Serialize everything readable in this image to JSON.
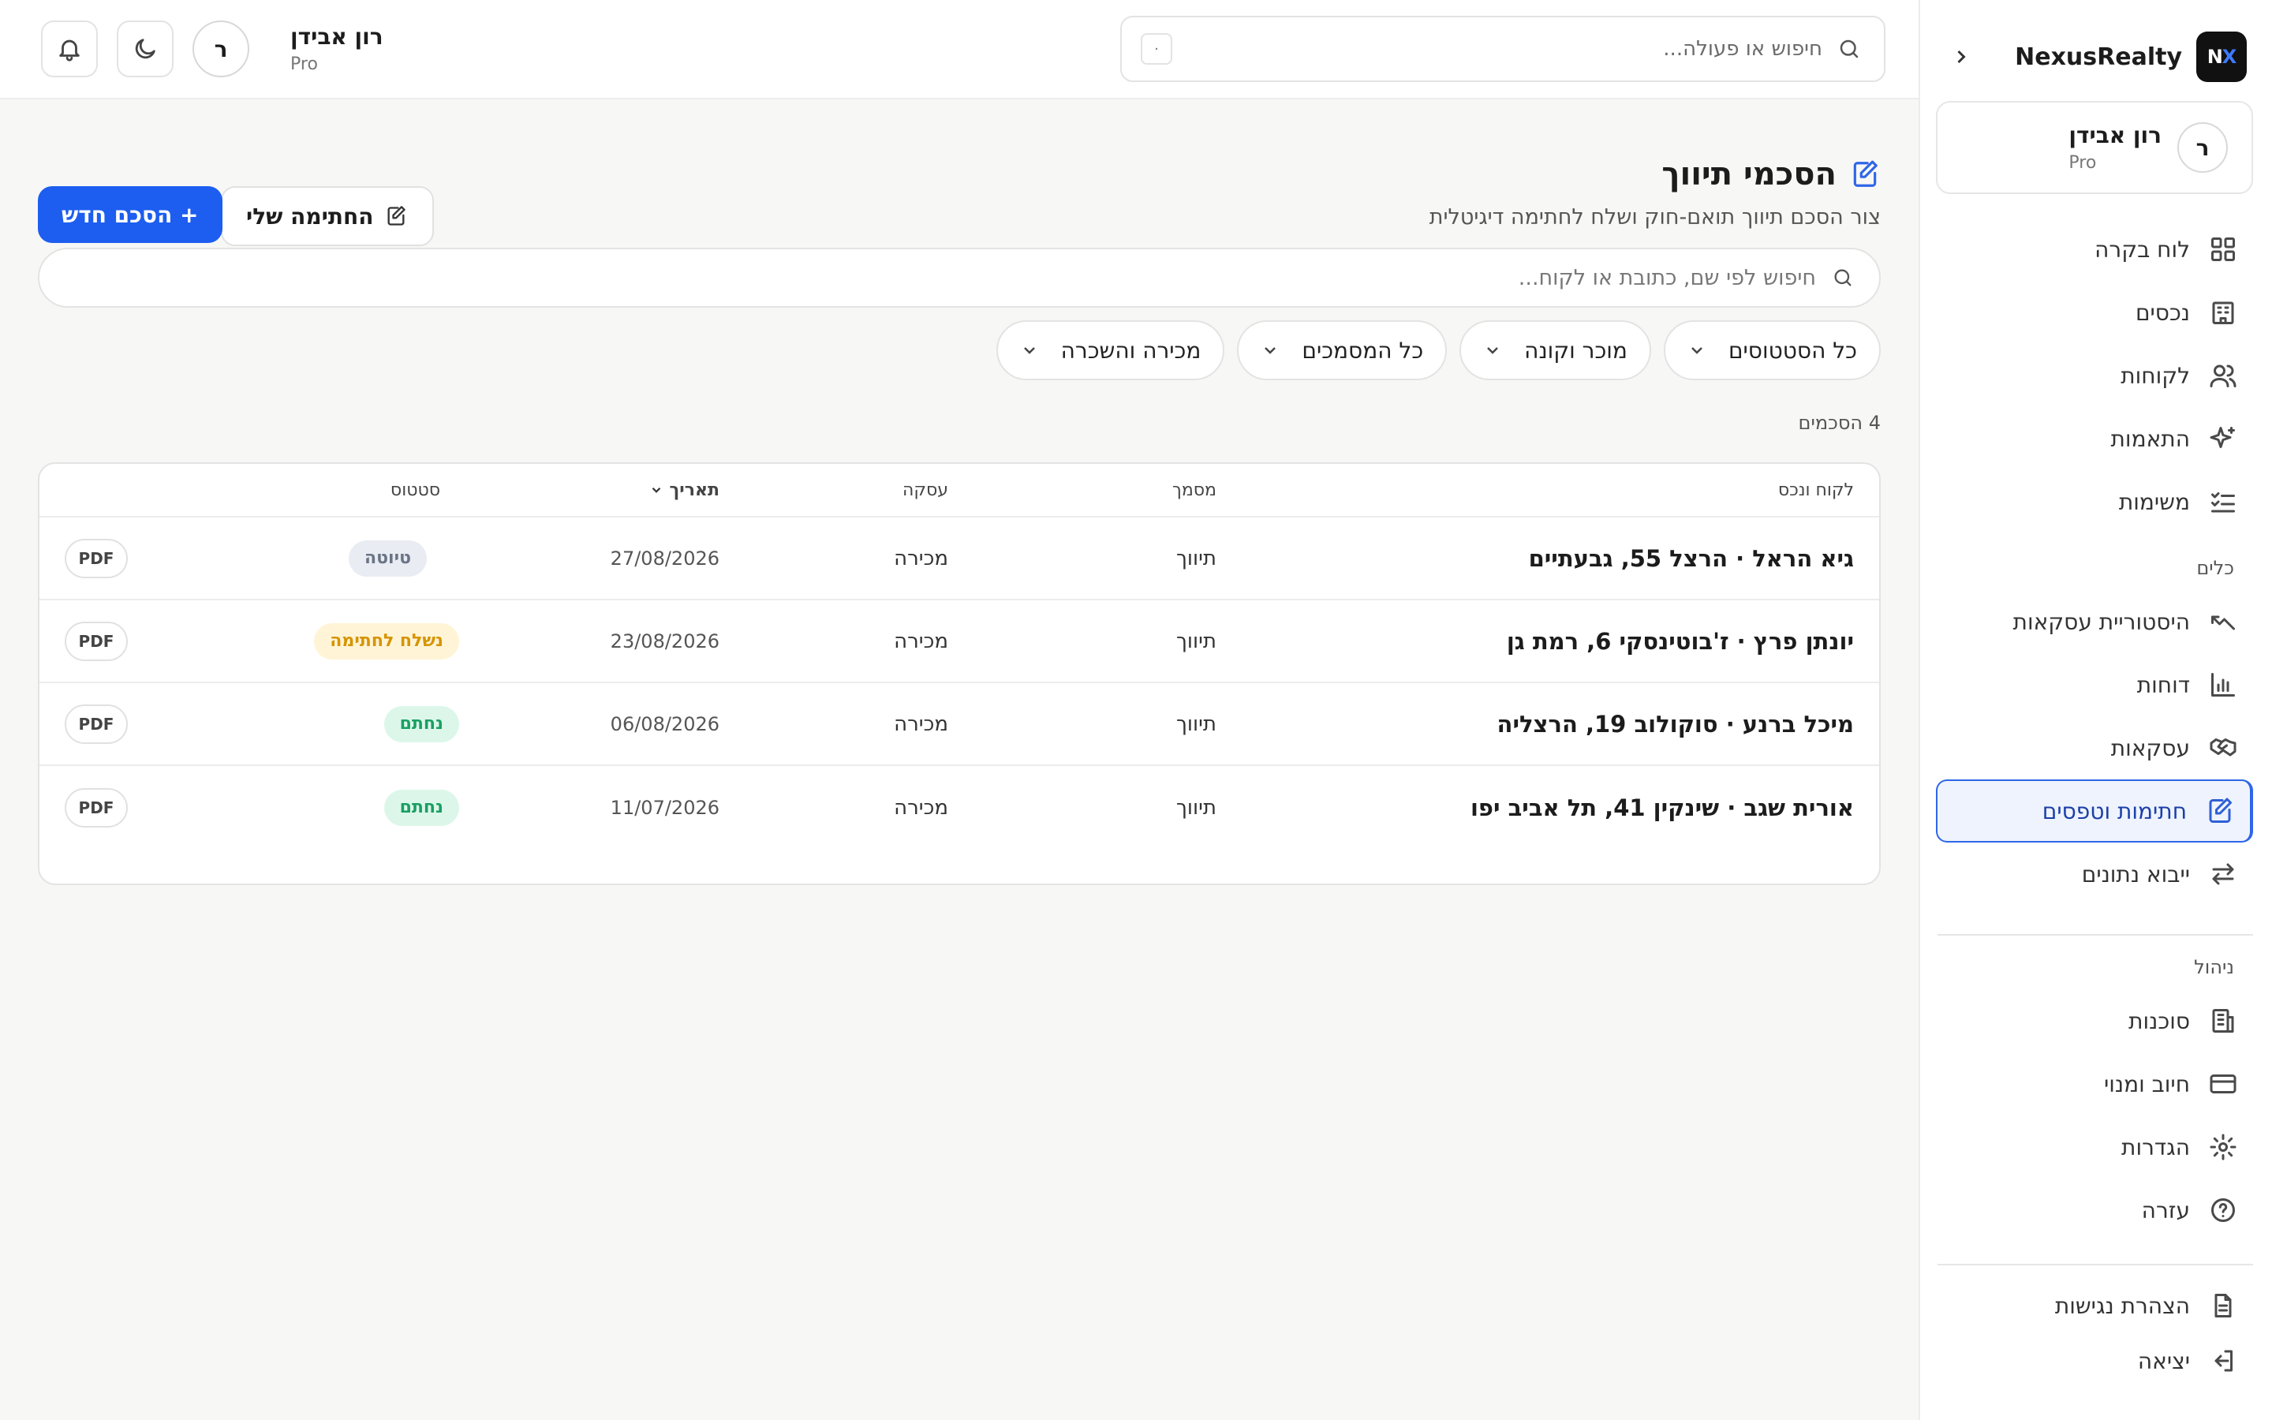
{
  "brand": {
    "name": "NexusRealty",
    "logo_text": "NX"
  },
  "user": {
    "name": "רון אבידן",
    "plan": "Pro",
    "initial": "ר"
  },
  "sidebar": {
    "items": [
      {
        "label": "לוח בקרה",
        "icon": "dashboard-icon"
      },
      {
        "label": "נכסים",
        "icon": "building-icon"
      },
      {
        "label": "לקוחות",
        "icon": "users-icon"
      },
      {
        "label": "התאמות",
        "icon": "sparkles-icon"
      },
      {
        "label": "משימות",
        "icon": "checklist-icon"
      }
    ],
    "tools_title": "כלים",
    "tools": [
      {
        "label": "היסטוריית עסקאות",
        "icon": "trend-icon"
      },
      {
        "label": "דוחות",
        "icon": "bar-chart-icon"
      },
      {
        "label": "עסקאות",
        "icon": "handshake-icon"
      },
      {
        "label": "חתימות וטפסים",
        "icon": "signature-icon",
        "active": true
      },
      {
        "label": "ייבוא נתונים",
        "icon": "arrows-icon"
      }
    ],
    "admin_title": "ניהול",
    "admin": [
      {
        "label": "סוכנות",
        "icon": "office-icon"
      },
      {
        "label": "חיוב ומנוי",
        "icon": "credit-card-icon"
      },
      {
        "label": "הגדרות",
        "icon": "gear-icon"
      },
      {
        "label": "עזרה",
        "icon": "help-icon"
      }
    ],
    "footer": [
      {
        "label": "הצהרת נגישות",
        "icon": "document-icon"
      },
      {
        "label": "יציאה",
        "icon": "logout-icon"
      }
    ]
  },
  "topbar": {
    "search_placeholder": "חיפוש או פעולה...",
    "shortcut": "·"
  },
  "page": {
    "title": "הסכמי תיווך",
    "subtitle": "צור הסכם תיווך תואם-חוק ושלח לחתימה דיגיטלית",
    "new_button": "+ הסכם חדש",
    "signature_button": "החתימה שלי",
    "search_placeholder": "חיפוש לפי שם, כתובת או לקוח...",
    "filters": [
      "כל הסטטוסים",
      "מוכר וקונה",
      "כל המסמכים",
      "מכירה והשכרה"
    ],
    "count_label": "4 הסכמים"
  },
  "table": {
    "columns": {
      "client": "לקוח ונכס",
      "doc": "מסמך",
      "deal": "עסקה",
      "date": "תאריך",
      "status": "סטטוס"
    },
    "pdf_label": "PDF",
    "rows": [
      {
        "client": "גיא הראל · הרצל 55, גבעתיים",
        "doc": "תיווך",
        "deal": "מכירה",
        "date": "27/08/2026",
        "status": "טיוטה",
        "status_type": "draft"
      },
      {
        "client": "יונתן פרץ · ז'בוטינסקי 6, רמת גן",
        "doc": "תיווך",
        "deal": "מכירה",
        "date": "23/08/2026",
        "status": "נשלח לחתימה",
        "status_type": "sent"
      },
      {
        "client": "מיכל ברנע · סוקולוב 19, הרצליה",
        "doc": "תיווך",
        "deal": "מכירה",
        "date": "06/08/2026",
        "status": "נחתם",
        "status_type": "signed"
      },
      {
        "client": "אורית שגב · שינקין 41, תל אביב יפו",
        "doc": "תיווך",
        "deal": "מכירה",
        "date": "11/07/2026",
        "status": "נחתם",
        "status_type": "signed"
      }
    ]
  },
  "colors": {
    "accent": "#1d5ef0",
    "draft": "#6a7485",
    "sent": "#d69400",
    "signed": "#1a9f62"
  }
}
